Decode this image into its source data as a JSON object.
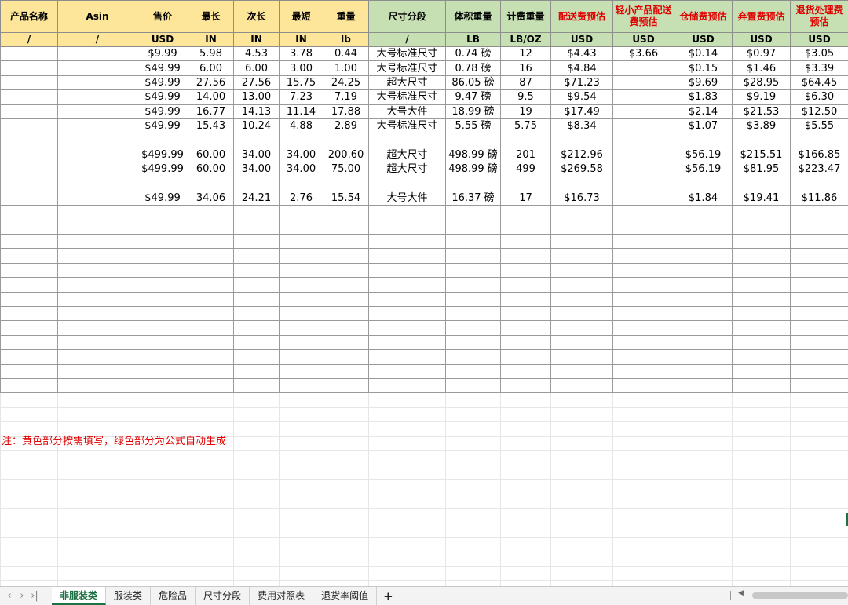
{
  "columns": [
    {
      "key": "name",
      "header": "产品名称",
      "unit": "/",
      "color": "y",
      "red": false
    },
    {
      "key": "asin",
      "header": "Asin",
      "unit": "/",
      "color": "y",
      "red": false
    },
    {
      "key": "price",
      "header": "售价",
      "unit": "USD",
      "color": "y",
      "red": false
    },
    {
      "key": "longest",
      "header": "最长",
      "unit": "IN",
      "color": "y",
      "red": false
    },
    {
      "key": "median",
      "header": "次长",
      "unit": "IN",
      "color": "y",
      "red": false
    },
    {
      "key": "shortest",
      "header": "最短",
      "unit": "IN",
      "color": "y",
      "red": false
    },
    {
      "key": "weight",
      "header": "重量",
      "unit": "lb",
      "color": "y",
      "red": false
    },
    {
      "key": "tier",
      "header": "尺寸分段",
      "unit": "/",
      "color": "g",
      "red": false
    },
    {
      "key": "dim_weight",
      "header": "体积重量",
      "unit": "LB",
      "color": "g",
      "red": false
    },
    {
      "key": "billing_weight",
      "header": "计费重量",
      "unit": "LB/OZ",
      "color": "g",
      "red": false
    },
    {
      "key": "fba_fee",
      "header": "配送费预估",
      "unit": "USD",
      "color": "g",
      "red": true
    },
    {
      "key": "light_fee",
      "header": "轻小产品配送费预估",
      "unit": "USD",
      "color": "g",
      "red": true
    },
    {
      "key": "storage_fee",
      "header": "仓储费预估",
      "unit": "USD",
      "color": "g",
      "red": true
    },
    {
      "key": "disposal_fee",
      "header": "弃置费预估",
      "unit": "USD",
      "color": "g",
      "red": true
    },
    {
      "key": "return_fee",
      "header": "退货处理费预估",
      "unit": "USD",
      "color": "g",
      "red": true
    }
  ],
  "rows": [
    [
      "",
      "",
      "$9.99",
      "5.98",
      "4.53",
      "3.78",
      "0.44",
      "大号标准尺寸",
      "0.74 磅",
      "12",
      "$4.43",
      "$3.66",
      "$0.14",
      "$0.97",
      "$3.05"
    ],
    [
      "",
      "",
      "$49.99",
      "6.00",
      "6.00",
      "3.00",
      "1.00",
      "大号标准尺寸",
      "0.78 磅",
      "16",
      "$4.84",
      "",
      "$0.15",
      "$1.46",
      "$3.39"
    ],
    [
      "",
      "",
      "$49.99",
      "27.56",
      "27.56",
      "15.75",
      "24.25",
      "超大尺寸",
      "86.05 磅",
      "87",
      "$71.23",
      "",
      "$9.69",
      "$28.95",
      "$64.45"
    ],
    [
      "",
      "",
      "$49.99",
      "14.00",
      "13.00",
      "7.23",
      "7.19",
      "大号标准尺寸",
      "9.47 磅",
      "9.5",
      "$9.54",
      "",
      "$1.83",
      "$9.19",
      "$6.30"
    ],
    [
      "",
      "",
      "$49.99",
      "16.77",
      "14.13",
      "11.14",
      "17.88",
      "大号大件",
      "18.99 磅",
      "19",
      "$17.49",
      "",
      "$2.14",
      "$21.53",
      "$12.50"
    ],
    [
      "",
      "",
      "$49.99",
      "15.43",
      "10.24",
      "4.88",
      "2.89",
      "大号标准尺寸",
      "5.55 磅",
      "5.75",
      "$8.34",
      "",
      "$1.07",
      "$3.89",
      "$5.55"
    ],
    [
      "",
      "",
      "",
      "",
      "",
      "",
      "",
      "",
      "",
      "",
      "",
      "",
      "",
      "",
      ""
    ],
    [
      "",
      "",
      "$499.99",
      "60.00",
      "34.00",
      "34.00",
      "200.60",
      "超大尺寸",
      "498.99 磅",
      "201",
      "$212.96",
      "",
      "$56.19",
      "$215.51",
      "$166.85"
    ],
    [
      "",
      "",
      "$499.99",
      "60.00",
      "34.00",
      "34.00",
      "75.00",
      "超大尺寸",
      "498.99 磅",
      "499",
      "$269.58",
      "",
      "$56.19",
      "$81.95",
      "$223.47"
    ],
    [
      "",
      "",
      "",
      "",
      "",
      "",
      "",
      "",
      "",
      "",
      "",
      "",
      "",
      "",
      ""
    ],
    [
      "",
      "",
      "$49.99",
      "34.06",
      "24.21",
      "2.76",
      "15.54",
      "大号大件",
      "16.37 磅",
      "17",
      "$16.73",
      "",
      "$1.84",
      "$19.41",
      "$11.86"
    ]
  ],
  "note": "注：黄色部分按需填写，绿色部分为公式自动生成",
  "sheet_tabs": [
    {
      "label": "非服装类",
      "active": true
    },
    {
      "label": "服装类",
      "active": false
    },
    {
      "label": "危险品",
      "active": false
    },
    {
      "label": "尺寸分段",
      "active": false
    },
    {
      "label": "费用对照表",
      "active": false
    },
    {
      "label": "退货率阈值",
      "active": false
    }
  ],
  "nav_icons": [
    "chevron-left-icon",
    "chevron-right-icon",
    "chevron-last-icon"
  ],
  "colors": {
    "yellow": "#fde59a",
    "green": "#c6e0b4",
    "red_text": "#e00000",
    "accent": "#1e7145"
  }
}
